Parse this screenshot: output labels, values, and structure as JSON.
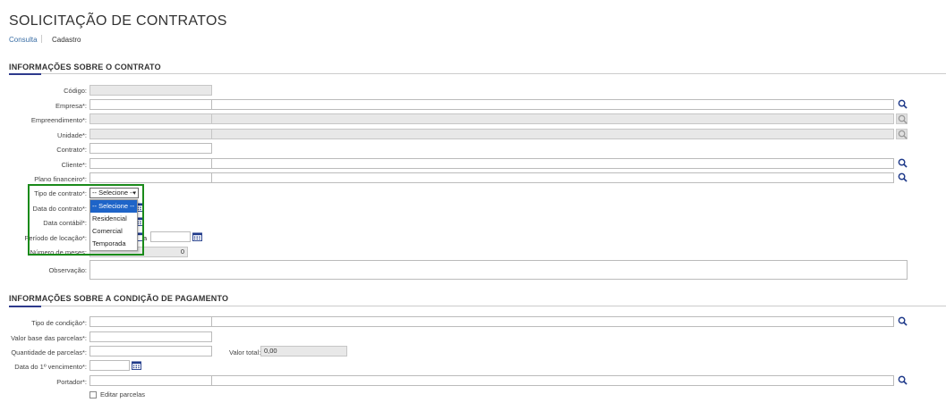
{
  "page": {
    "title": "SOLICITAÇÃO DE CONTRATOS",
    "breadcrumb": [
      "Consulta",
      "Cadastro"
    ]
  },
  "contract_section": {
    "title": "INFORMAÇÕES SOBRE O CONTRATO",
    "labels": {
      "codigo": "Código:",
      "empresa": "Empresa*:",
      "empreendimento": "Empreendimento*:",
      "unidade": "Unidade*:",
      "contrato": "Contrato*:",
      "cliente": "Cliente*:",
      "plano": "Plano financeiro*:",
      "tipo": "Tipo de contrato*:",
      "data_contrato": "Data do contrato*:",
      "data_contabil": "Data contábil*:",
      "periodo": "Período de locação*:",
      "periodo_sep": "a",
      "meses": "Número de meses:",
      "observacao": "Observação:"
    },
    "values": {
      "meses": "0"
    },
    "tipo_select": {
      "selected": "-- Selecione --",
      "options": [
        "-- Selecione --",
        "Residencial",
        "Comercial",
        "Temporada"
      ]
    }
  },
  "payment_section": {
    "title": "INFORMAÇÕES SOBRE A CONDIÇÃO DE PAGAMENTO",
    "labels": {
      "tipo_condicao": "Tipo de condição*:",
      "valor_base": "Valor base das parcelas*:",
      "quantidade": "Quantidade de parcelas*:",
      "valor_total": "Valor total:",
      "data_venc": "Data do 1º vencimento*:",
      "portador": "Portador*:",
      "editar": "Editar parcelas"
    },
    "values": {
      "valor_total": "0,00"
    }
  },
  "colors": {
    "accent": "#2d3a8c",
    "highlight_box": "#1a8a1a",
    "selected_option": "#1e64c8",
    "link": "#3a6ea5"
  },
  "icons": [
    "search-icon",
    "calendar-icon",
    "chevron-down-icon"
  ]
}
